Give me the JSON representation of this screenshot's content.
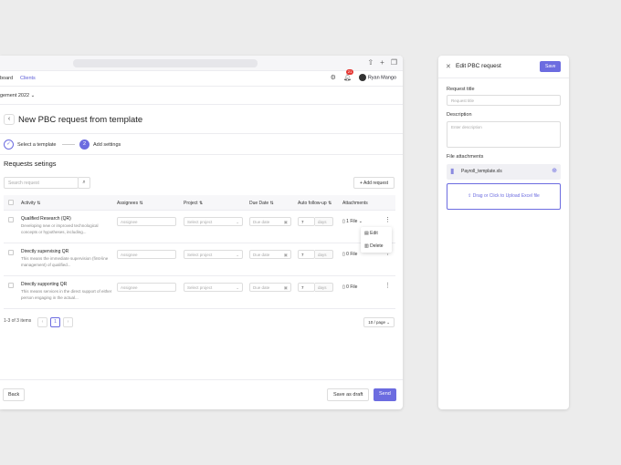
{
  "window": {
    "nav": {
      "dashboard": "board",
      "clients": "Clients",
      "notifications": "21",
      "user": "Ryan Mango"
    },
    "engagement": "gement 2022",
    "page_title": "New PBC request from template",
    "steps": [
      {
        "label": "Select a template",
        "state": "done"
      },
      {
        "label": "Add settings",
        "num": "2",
        "state": "current"
      }
    ],
    "section_title": "Requests setings",
    "search_placeholder": "Search request",
    "add_request": "+ Add request",
    "columns": {
      "activity": "Activity",
      "assignees": "Assignees",
      "project": "Project",
      "due": "Due Date",
      "followup": "Auto follow-up",
      "attachments": "Attachments"
    },
    "rows": [
      {
        "title": "Qualified Research (QR)",
        "desc": "Developing new or improved technological concepts or hypotheses, including...",
        "assignee": "Assignee",
        "project": "Select project",
        "due": "Due date",
        "followup": "7",
        "unit": "days",
        "attachments": "1 File"
      },
      {
        "title": "Directly supervising QR",
        "desc": "This means the immediate supervision (first-line management) of qualified...",
        "assignee": "Assignee",
        "project": "Select project",
        "due": "Due date",
        "followup": "7",
        "unit": "days",
        "attachments": "0 File"
      },
      {
        "title": "Directly supporting QR",
        "desc": "This means services in the direct support of either person engaging in the actual...",
        "assignee": "Assignee",
        "project": "Select project",
        "due": "Due date",
        "followup": "7",
        "unit": "days",
        "attachments": "0 File"
      }
    ],
    "menu": {
      "edit": "Edit",
      "delete": "Delete"
    },
    "pager": {
      "summary": "1-3 of 3 items",
      "page": "1",
      "per_page": "10 / page"
    },
    "footer": {
      "back": "Back",
      "draft": "Save as draft",
      "send": "Send"
    }
  },
  "panel": {
    "title": "Edit PBC request",
    "save": "Save",
    "req_title_label": "Request title",
    "req_title_placeholder": "Request title",
    "desc_label": "Description",
    "desc_placeholder": "Enter description",
    "att_label": "File attachments",
    "file_name": "Payroll_template.xls",
    "drop_text": "Drag or Click to Upload Excel file"
  },
  "colors": {
    "accent": "#6c6ce0",
    "badge": "#e53935"
  }
}
